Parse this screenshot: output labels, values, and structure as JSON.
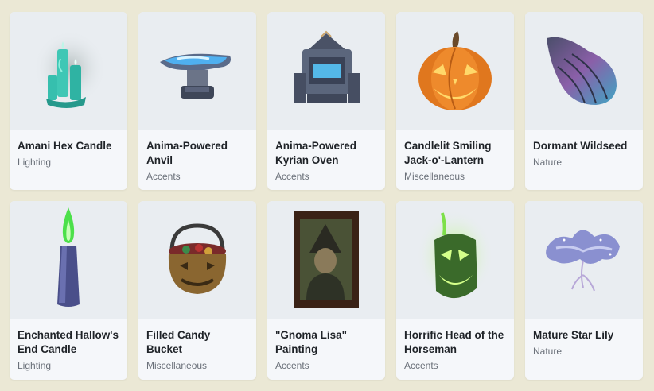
{
  "items": [
    {
      "name": "Amani Hex Candle",
      "category": "Lighting",
      "icon": "teal-candles-icon"
    },
    {
      "name": "Anima-Powered Anvil",
      "category": "Accents",
      "icon": "anvil-icon"
    },
    {
      "name": "Anima-Powered Kyrian Oven",
      "category": "Accents",
      "icon": "oven-icon"
    },
    {
      "name": "Candlelit Smiling Jack-o'-Lantern",
      "category": "Miscellaneous",
      "icon": "jack-o-lantern-icon"
    },
    {
      "name": "Dormant Wildseed",
      "category": "Nature",
      "icon": "wildseed-icon"
    },
    {
      "name": "Enchanted Hallow's End Candle",
      "category": "Lighting",
      "icon": "green-candle-icon"
    },
    {
      "name": "Filled Candy Bucket",
      "category": "Miscellaneous",
      "icon": "candy-bucket-icon"
    },
    {
      "name": "\"Gnoma Lisa\" Painting",
      "category": "Accents",
      "icon": "painting-icon"
    },
    {
      "name": "Horrific Head of the Horseman",
      "category": "Accents",
      "icon": "horseman-head-icon"
    },
    {
      "name": "Mature Star Lily",
      "category": "Nature",
      "icon": "star-lily-icon"
    }
  ]
}
